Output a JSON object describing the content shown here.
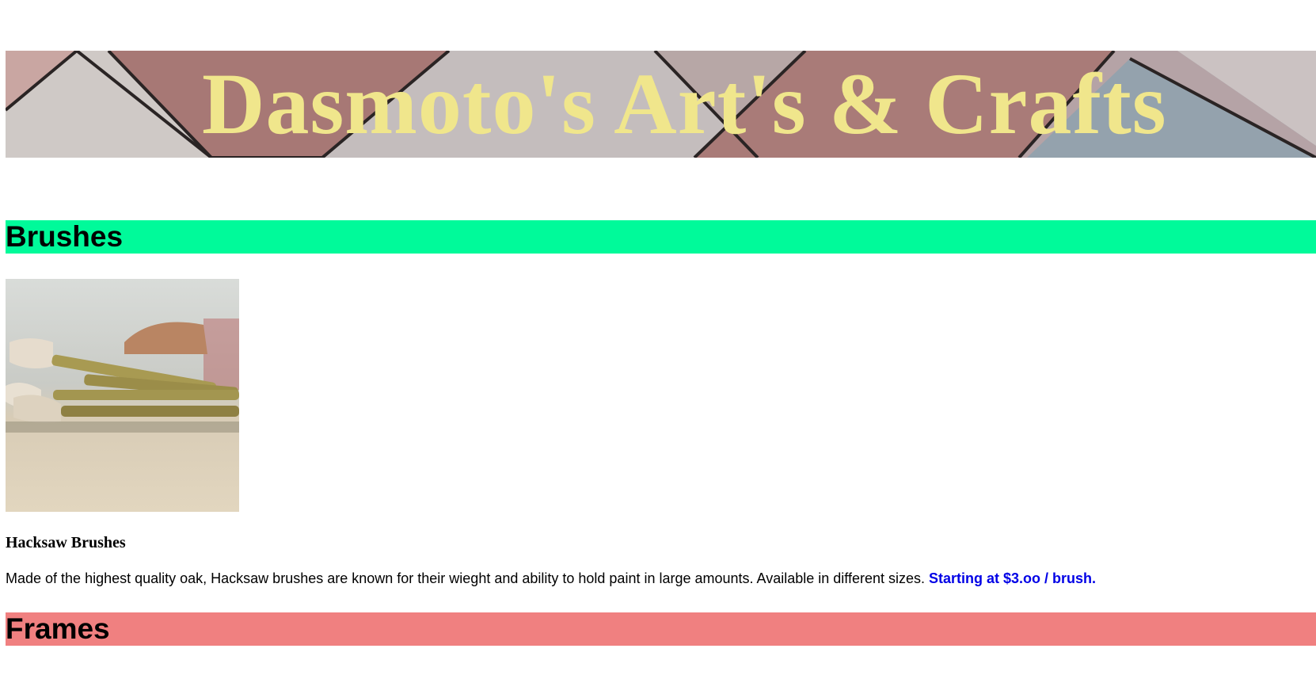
{
  "header": {
    "title": "Dasmoto's Art's & Crafts",
    "title_color": "#f0e68c"
  },
  "sections": {
    "brushes": {
      "heading": "Brushes",
      "color": "#00fa9a",
      "product": {
        "image_icon": "paintbrushes-photo",
        "name": "Hacksaw Brushes",
        "description": "Made of the highest quality oak, Hacksaw brushes are known for their wieght and ability to hold paint in large amounts. Available in different sizes.",
        "price": "Starting at $3.oo / brush.",
        "price_color": "#0000e6"
      }
    },
    "frames": {
      "heading": "Frames",
      "color": "#f08080"
    }
  }
}
